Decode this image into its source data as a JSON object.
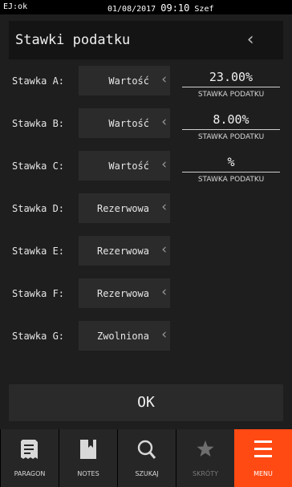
{
  "status_bar": {
    "left": "EJ:ok",
    "date": "01/08/2017",
    "time": "09:10",
    "user": "Szef"
  },
  "header": {
    "title": "Stawki podatku",
    "back_glyph": "‹"
  },
  "caption": "STAWKA PODATKU",
  "rows": [
    {
      "label": "Stawka A:",
      "value": "Wartość",
      "rate": "23.00%"
    },
    {
      "label": "Stawka B:",
      "value": "Wartość",
      "rate": "8.00%"
    },
    {
      "label": "Stawka C:",
      "value": "Wartość",
      "rate": "%"
    },
    {
      "label": "Stawka D:",
      "value": "Rezerwowa"
    },
    {
      "label": "Stawka E:",
      "value": "Rezerwowa"
    },
    {
      "label": "Stawka F:",
      "value": "Rezerwowa"
    },
    {
      "label": "Stawka G:",
      "value": "Zwolniona"
    }
  ],
  "ok_button": "OK",
  "nav": [
    {
      "label": "PARAGON",
      "icon": "receipt-icon"
    },
    {
      "label": "NOTES",
      "icon": "notebook-icon"
    },
    {
      "label": "SZUKAJ",
      "icon": "search-icon"
    },
    {
      "label": "SKRÓTY",
      "icon": "star-icon",
      "disabled": true
    },
    {
      "label": "MENU",
      "icon": "hamburger-menu-icon",
      "active": true
    }
  ],
  "colors": {
    "accent": "#ff4a13",
    "background": "#1e1e1e"
  }
}
